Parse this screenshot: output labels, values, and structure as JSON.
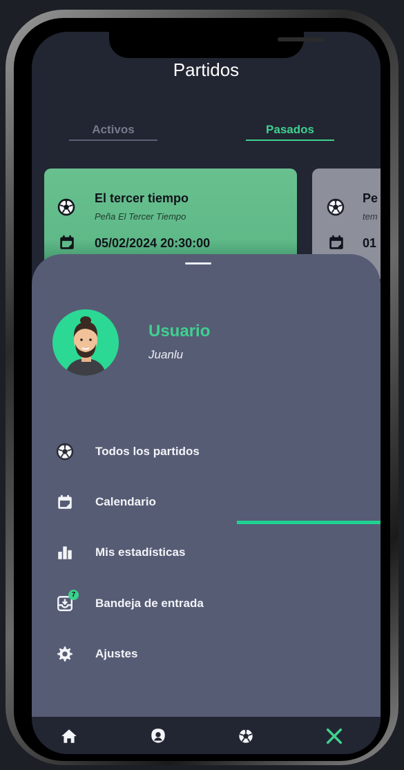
{
  "header": {
    "title": "Partidos"
  },
  "tabs": [
    {
      "label": "Activos"
    },
    {
      "label": "Pasados"
    }
  ],
  "cards": [
    {
      "title": "El tercer tiempo",
      "subtitle": "Peña El Tercer Tiempo",
      "date": "05/02/2024 20:30:00"
    },
    {
      "title": "Pe",
      "subtitle": "tem",
      "date": "01"
    }
  ],
  "profile": {
    "label": "Usuario",
    "username": "Juanlu"
  },
  "menu": {
    "items": [
      {
        "label": "Todos los partidos",
        "icon": "soccer-ball-icon"
      },
      {
        "label": "Calendario",
        "icon": "calendar-icon"
      },
      {
        "label": "Mis estadísticas",
        "icon": "bar-chart-icon"
      },
      {
        "label": "Bandeja de entrada",
        "icon": "inbox-icon",
        "badge": "7"
      },
      {
        "label": "Ajustes",
        "icon": "gear-icon"
      }
    ]
  },
  "bottom_nav": [
    {
      "icon": "home-icon"
    },
    {
      "icon": "user-icon"
    },
    {
      "icon": "soccer-ball-icon"
    },
    {
      "icon": "close-icon"
    }
  ],
  "colors": {
    "accent": "#3fd190",
    "background": "#222532",
    "sheet": "#575c75",
    "card_active": "#66bd8c",
    "card_inactive": "#8d909b"
  }
}
